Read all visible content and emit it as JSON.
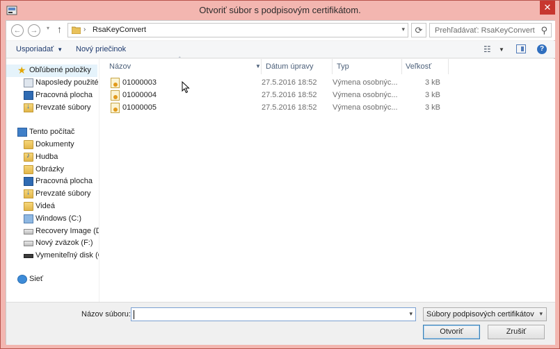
{
  "window": {
    "title": "Otvoriť súbor s podpisovým certifikátom.",
    "close_glyph": "✕"
  },
  "address_bar": {
    "back_glyph": "←",
    "forward_glyph": "→",
    "recent_glyph": "▾",
    "up_glyph": "↑",
    "breadcrumb_separator": "›",
    "path": "RsaKeyConvert",
    "dropdown_glyph": "▾",
    "refresh_glyph": "⟳",
    "search_placeholder": "Prehľadávať: RsaKeyConvert",
    "search_glyph": "⚲"
  },
  "toolbar": {
    "organize_label": "Usporiadať",
    "organize_caret": "▼",
    "new_folder_label": "Nový priečinok",
    "view_glyph": "☷",
    "view_caret": "▼",
    "help_glyph": "?"
  },
  "nav_pane": {
    "favorites": {
      "label": "Obľúbené položky",
      "items": [
        {
          "label": "Naposledy použité",
          "icon": "recent-places-icon"
        },
        {
          "label": "Pracovná plocha",
          "icon": "desktop-icon"
        },
        {
          "label": "Prevzaté súbory",
          "icon": "downloads-icon"
        }
      ]
    },
    "this_pc": {
      "label": "Tento počítač",
      "items": [
        {
          "label": "Dokumenty",
          "icon": "documents-icon"
        },
        {
          "label": "Hudba",
          "icon": "music-icon"
        },
        {
          "label": "Obrázky",
          "icon": "pictures-icon"
        },
        {
          "label": "Pracovná plocha",
          "icon": "desktop-icon"
        },
        {
          "label": "Prevzaté súbory",
          "icon": "downloads-icon"
        },
        {
          "label": "Videá",
          "icon": "videos-icon"
        },
        {
          "label": "Windows  (C:)",
          "icon": "windows-drive-icon"
        },
        {
          "label": "Recovery Image (D:)",
          "icon": "drive-icon"
        },
        {
          "label": "Nový zväzok (F:)",
          "icon": "drive-icon"
        },
        {
          "label": "Vymeniteľný disk (G",
          "icon": "removable-drive-icon"
        }
      ]
    },
    "network": {
      "label": "Sieť"
    }
  },
  "file_list": {
    "columns": {
      "name": "Názov",
      "modified": "Dátum úpravy",
      "type": "Typ",
      "size": "Veľkosť"
    },
    "sort_glyph": "ˆ",
    "name_dropdown_glyph": "▼",
    "files": [
      {
        "name": "01000003",
        "modified": "27.5.2016 18:52",
        "type": "Výmena osobnýc...",
        "size": "3 kB"
      },
      {
        "name": "01000004",
        "modified": "27.5.2016 18:52",
        "type": "Výmena osobnýc...",
        "size": "3 kB"
      },
      {
        "name": "01000005",
        "modified": "27.5.2016 18:52",
        "type": "Výmena osobnýc...",
        "size": "3 kB"
      }
    ]
  },
  "bottom": {
    "filename_label": "Názov súboru:",
    "filename_value": "",
    "filename_dropdown_glyph": "▾",
    "filter_value": "Súbory podpisových certifikátov",
    "filter_dropdown_glyph": "▾",
    "open_label": "Otvoriť",
    "cancel_label": "Zrušiť"
  }
}
